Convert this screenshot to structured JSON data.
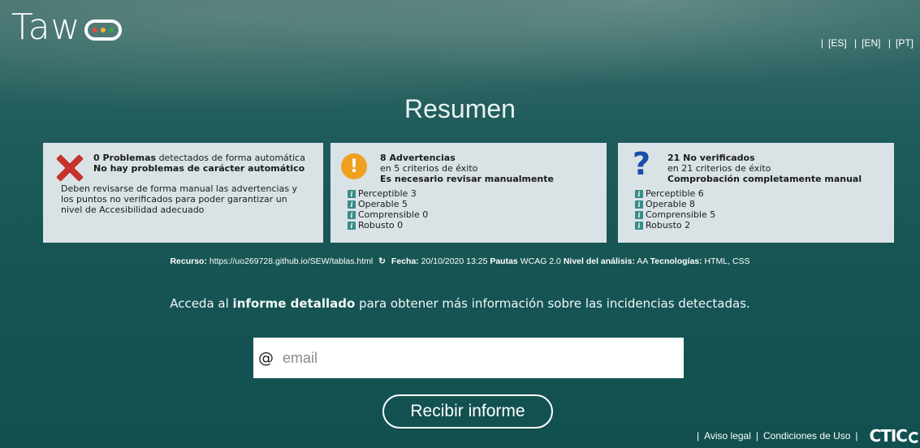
{
  "logo": {
    "text": "Taw",
    "dot_colors": [
      "#e24a3b",
      "#f2b136",
      "#35a853"
    ]
  },
  "languages": [
    "[ES]",
    "[EN]",
    "[PT]"
  ],
  "title": "Resumen",
  "problems": {
    "count_label": "0 Problemas",
    "desc": "detectados de forma automática",
    "subtitle": "No hay problemas de carácter automático",
    "note": "Deben revisarse de forma manual las advertencias y los puntos no verificados para poder garantizar un nivel de Accesibilidad adecuado"
  },
  "warnings": {
    "title": "8 Advertencias",
    "criteria": "en 5 criterios de éxito",
    "subtitle": "Es necesario revisar manualmente",
    "items": [
      {
        "label": "Perceptible 3"
      },
      {
        "label": "Operable 5"
      },
      {
        "label": "Comprensible 0"
      },
      {
        "label": "Robusto 0"
      }
    ]
  },
  "unverified": {
    "title": "21 No verificados",
    "criteria": "en 21 criterios de éxito",
    "subtitle": "Comprobación completamente manual",
    "items": [
      {
        "label": "Perceptible 6"
      },
      {
        "label": "Operable 8"
      },
      {
        "label": "Comprensible 5"
      },
      {
        "label": "Robusto 2"
      }
    ]
  },
  "meta": {
    "resource_label": "Recurso:",
    "resource_value": "https://uo269728.github.io/SEW/tablas.html",
    "date_label": "Fecha:",
    "date_value": "20/10/2020 13:25",
    "guidelines_label": "Pautas",
    "guidelines_value": "WCAG 2.0",
    "level_label": "Nivel del análisis:",
    "level_value": "AA",
    "tech_label": "Tecnologías:",
    "tech_value": "HTML, CSS"
  },
  "cta": {
    "before": "Acceda al",
    "bold": "informe detallado",
    "after": "para obtener más información sobre las incidencias detectadas."
  },
  "email": {
    "placeholder": "email",
    "at_symbol": "@"
  },
  "button": {
    "label": "Recibir informe"
  },
  "footer": {
    "legal": "Aviso legal",
    "terms": "Condiciones de Uso",
    "brand": "CTIC"
  },
  "colors": {
    "background": "#165554",
    "card": "#d9e3e6",
    "error": "#c8322c",
    "warning": "#f0a020",
    "question": "#1a4fa8",
    "info": "#3a8a8a"
  }
}
